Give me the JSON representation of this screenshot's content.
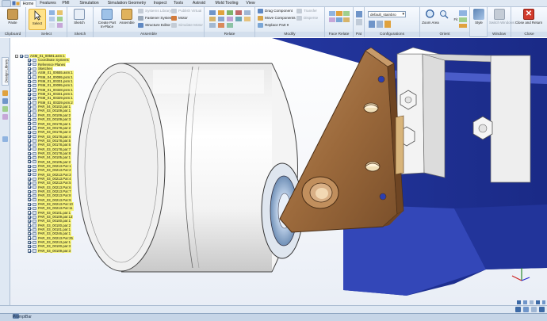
{
  "tabs": [
    "Home",
    "Features",
    "PMI",
    "Simulation",
    "Simulation Geometry",
    "Inspect",
    "Tools",
    "Astroid",
    "Mold Tooling",
    "View"
  ],
  "active_tab": "Home",
  "ribbon": {
    "clipboard": {
      "label": "Clipboard",
      "paste": "Paste"
    },
    "select": {
      "label": "Select",
      "select": "Select"
    },
    "sketch": {
      "label": "Sketch",
      "sketch": "Sketch"
    },
    "assemble": {
      "label": "Assemble",
      "create_part": "Create Part In-Place",
      "assemble": "Assemble",
      "systems_library": "Systems Library",
      "fastener_system": "Fastener System",
      "structure_editor": "Structure Editor",
      "publish_virtual": "Publish Virtual",
      "motor": "Motor",
      "simulate_motor": "Simulate Motor"
    },
    "relate": {
      "label": "Relate"
    },
    "modify": {
      "label": "Modify",
      "drag_component": "Drag Component",
      "move_components": "Move Components",
      "replace_part": "Replace Part",
      "transfer": "Transfer",
      "disperse": "Disperse"
    },
    "face_relate": {
      "label": "Face Relate"
    },
    "pat": {
      "label": "Pat"
    },
    "configurations": {
      "label": "Configurations",
      "value": "default_stainbro"
    },
    "orient": {
      "label": "Orient",
      "zoom_area": "Zoom Area",
      "fit": "Fit"
    },
    "style": {
      "style": "Style"
    },
    "window": {
      "label": "Window",
      "switch_windows": "Switch Windows"
    },
    "close": {
      "label": "Close",
      "close_and_return": "Close and Return"
    }
  },
  "left_strip": {
    "library": "Design Library"
  },
  "tree": {
    "root": "ASM_01_00591.asm:1",
    "system_items": [
      "Coordinate Systems",
      "Reference Planes",
      "Sketches"
    ],
    "items": [
      "ASM_01_00655.asm:1",
      "PSM_04_00095.psm:1",
      "PSM_01_00331.psm:1",
      "PSM_01_00095.psm:1",
      "PSM_01_00328.psm:1",
      "PSM_01_00331.psm:1",
      "PSM_01_00329.psm:1",
      "PSM_01_00329.psm:2",
      "PAR_04_00102.par:1",
      "PAR_03_00109.par:1",
      "PAR_03_00109.par:2",
      "PAR_03_00109.par:3",
      "PAR_03_00178.par:1",
      "PAR_03_00178.par:2",
      "PAR_03_00178.par:3",
      "PAR_03_00178.par:4",
      "PAR_03_00178.par:5",
      "PAR_03_00178.par:6",
      "PAR_03_00178.par:7",
      "PAR_03_00178.par:8",
      "PAR_04_00105.par:1",
      "PAR_04_00105.par:2",
      "PAR_03_00213.Par:1",
      "PAR_03_00213.Par:2",
      "PAR_03_00213.Par:3",
      "PAR_03_00213.Par:4",
      "PAR_03_00213.Par:5",
      "PAR_03_00213.Par:6",
      "PAR_03_00213.Par:7",
      "PAR_03_00213.Par:8",
      "PAR_03_00213.Par:9",
      "PAR_03_00213.Par:10",
      "PAR_03_00213.Par:11",
      "PAR_03_00101.par:1",
      "PAR_03_00109.par:13",
      "PAR_03_00100.par:1",
      "PAR_03_00100.par:2",
      "PAR_03_00101.par:1",
      "PAR_03_00246.par:1",
      "PAR_03_00213.Par:25",
      "PAR_03_00213.par:1",
      "PAR_03_00100.par:3",
      "PAR_03_00109.par:3"
    ]
  },
  "prompt_bar": {
    "title": "PromptBar"
  },
  "colors": {
    "ribbon_bg": "#dde7f2",
    "tree_highlight": "#f6f37a",
    "frame_blue": "#2b3fb0",
    "bracket_bronze": "#9c6a3c",
    "roller_white": "#f2f2f2"
  }
}
